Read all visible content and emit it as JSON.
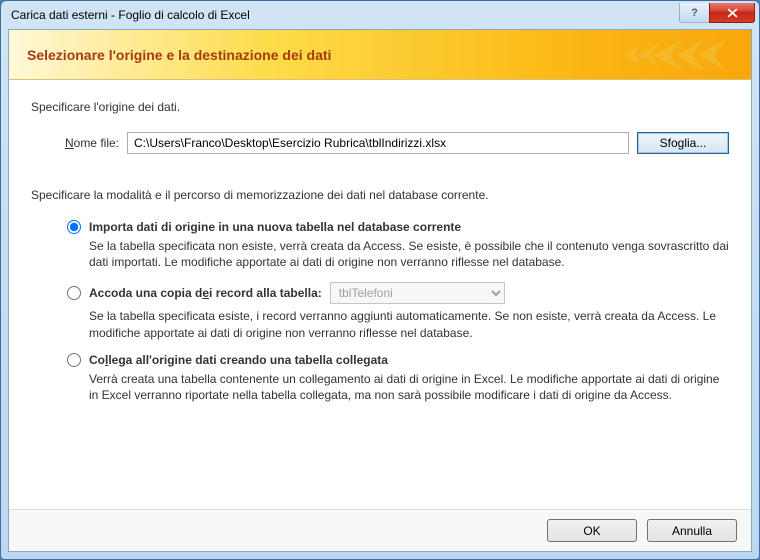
{
  "window": {
    "title": "Carica dati esterni - Foglio di calcolo di Excel"
  },
  "banner": {
    "heading": "Selezionare l'origine e la destinazione dei dati"
  },
  "section1": {
    "label": "Specificare l'origine dei dati.",
    "file_label_pre": "N",
    "file_label_rest": "ome file:",
    "file_path": "C:\\Users\\Franco\\Desktop\\Esercizio Rubrica\\tblIndirizzi.xlsx",
    "browse_pre": "Sfo",
    "browse_u": "g",
    "browse_post": "lia..."
  },
  "section2": {
    "label": "Specificare la modalità e il percorso di memorizzazione dei dati nel database corrente."
  },
  "opt_import": {
    "title": "Importa dati di origine in una nuova tabella nel database corrente",
    "desc": "Se la tabella specificata non esiste, verrà creata da Access. Se esiste, è possibile che il contenuto venga sovrascritto dai dati importati. Le modifiche apportate ai dati di origine non verranno riflesse nel database."
  },
  "opt_append": {
    "title_pre": "Accoda una copia d",
    "title_u": "e",
    "title_post": "i record alla tabella:",
    "selected_table": "tblTelefoni",
    "desc": "Se la tabella specificata esiste, i record verranno aggiunti automaticamente. Se non esiste, verrà creata da Access. Le modifiche apportate ai dati di origine non verranno riflesse nel database."
  },
  "opt_link": {
    "title_pre": "Co",
    "title_u": "l",
    "title_post": "lega all'origine dati creando una tabella collegata",
    "desc": "Verrà creata una tabella contenente un collegamento ai dati di origine in Excel. Le modifiche apportate ai dati di origine in Excel verranno riportate nella tabella collegata, ma non sarà possibile modificare i dati di origine da Access."
  },
  "footer": {
    "ok": "OK",
    "cancel": "Annulla"
  }
}
